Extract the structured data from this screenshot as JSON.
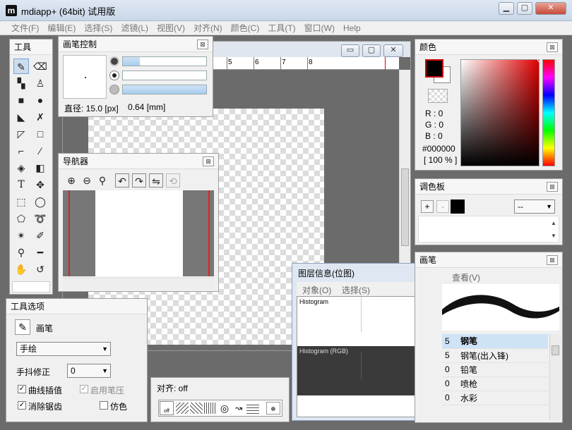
{
  "window": {
    "title": "mdiapp+ (64bit) 试用版",
    "icon_letter": "m",
    "controls": [
      "minimize",
      "maximize",
      "close"
    ]
  },
  "menubar": {
    "items": [
      "文件(F)",
      "编辑(E)",
      "选择(S)",
      "滤镜(L)",
      "视图(V)",
      "对齐(N)",
      "颜色(C)",
      "工具(T)",
      "窗口(W)",
      "Help"
    ]
  },
  "ruler": {
    "labels": [
      "5",
      "6",
      "7",
      "8"
    ]
  },
  "tools_panel": {
    "title": "工具"
  },
  "brush_control": {
    "title": "画笔控制",
    "diameter_label": "直径: 15.0 [px]",
    "diameter_mm": "0.64 [mm]",
    "slider_levels": [
      0.2,
      0.0,
      1.0
    ]
  },
  "navigator": {
    "title": "导航器"
  },
  "tool_options": {
    "title": "工具选项",
    "tool_name": "画笔",
    "mode_value": "手绘",
    "stabilizer_label": "手抖修正",
    "stabilizer_value": "0",
    "curve_interp_label": "曲线插值",
    "pen_pressure_label": "启用笔压",
    "antialias_label": "消除锯齿",
    "simulate_label": "仿色"
  },
  "snap_panel": {
    "title": "对齐: off",
    "off_label": "off"
  },
  "color_panel": {
    "title": "颜色",
    "r_label": "R : 0",
    "g_label": "G : 0",
    "b_label": "B : 0",
    "hex_label": "#000000",
    "opacity_label": "[ 100 % ]",
    "foreground": "#000000",
    "background": "#ffffff"
  },
  "palette_panel": {
    "title": "调色板",
    "add": "+",
    "remove": "-",
    "dropdown_value": "--"
  },
  "brush_panel": {
    "title": "画笔",
    "view_tab": "查看(V)",
    "rows": [
      {
        "num": "5",
        "name": "钢笔"
      },
      {
        "num": "5",
        "name": "钢笔(出入锋)"
      },
      {
        "num": "0",
        "name": "铅笔"
      },
      {
        "num": "0",
        "name": "喷枪"
      },
      {
        "num": "0",
        "name": "水彩"
      }
    ]
  },
  "layer_info": {
    "title": "图层信息(位图)",
    "menu_object": "对象(O)",
    "menu_select": "选择(S)",
    "histogram_label": "Histogram",
    "histogram_rgb_label": "Histogram (RGB)"
  }
}
